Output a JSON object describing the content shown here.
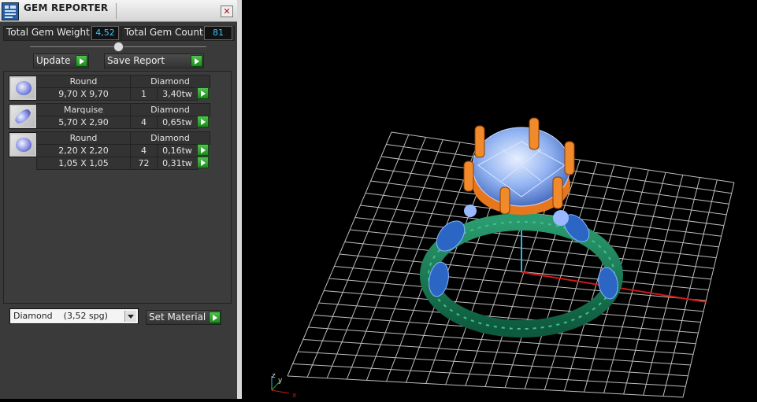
{
  "window": {
    "title": "GEM REPORTER",
    "close_glyph": "✕"
  },
  "stats": {
    "weight_label": "Total Gem Weight",
    "weight_value": "4,52",
    "count_label": "Total Gem Count",
    "count_value": "81"
  },
  "actions": {
    "update_label": "Update",
    "save_label": "Save Report"
  },
  "gem_groups": [
    {
      "shape": "Round",
      "material": "Diamond",
      "rows": [
        {
          "size": "9,70 X 9,70",
          "qty": "1",
          "weight": "3,40tw"
        }
      ]
    },
    {
      "shape": "Marquise",
      "material": "Diamond",
      "rows": [
        {
          "size": "5,70 X 2,90",
          "qty": "4",
          "weight": "0,65tw"
        }
      ]
    },
    {
      "shape": "Round",
      "material": "Diamond",
      "rows": [
        {
          "size": "2,20 X 2,20",
          "qty": "4",
          "weight": "0,16tw"
        },
        {
          "size": "1,05 X 1,05",
          "qty": "72",
          "weight": "0,31tw"
        }
      ]
    }
  ],
  "material": {
    "selected": "Diamond    (3,52 spg)",
    "set_label": "Set Material"
  },
  "viewport": {
    "axis_x": "x",
    "axis_y": "y",
    "axis_z": "z"
  },
  "colors": {
    "accent_value": "#37c6ff",
    "go_green": "#2fa52f",
    "prong_orange": "#e8761c",
    "metal_green": "#1d7a55",
    "gem_blue": "#9ab8ff",
    "grid": "#bfbfbf",
    "x_axis": "#d01818",
    "y_axis": "#2ab8e0"
  }
}
